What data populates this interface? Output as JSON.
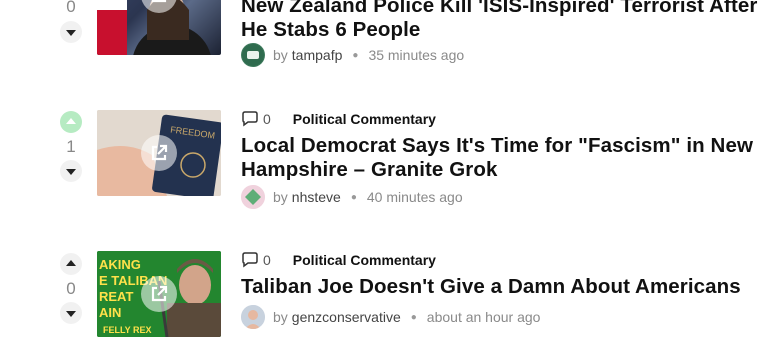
{
  "posts": [
    {
      "score": "0",
      "title": "New Zealand Police Kill 'ISIS-Inspired' Terrorist After He Stabs 6 People",
      "by_label": "by",
      "author": "tampafp",
      "time": "35 minutes ago",
      "avatar_icon": "tampafp-logo-icon",
      "thumb_icon": "news-photo"
    },
    {
      "score": "1",
      "comments": "0",
      "category": "Political Commentary",
      "title": "Local Democrat Says It's Time for \"Fascism\" in New Hampshire – Granite Grok",
      "by_label": "by",
      "author": "nhsteve",
      "time": "40 minutes ago",
      "upvoted": true,
      "passport_text": "FREEDOM"
    },
    {
      "score": "0",
      "comments": "0",
      "category": "Political Commentary",
      "title": "Taliban Joe Doesn't Give a Damn About Americans",
      "by_label": "by",
      "author": "genzconservative",
      "time": "about an hour ago",
      "thumb_text": [
        "AKING",
        "E TALIBAN",
        "REAT",
        "AIN",
        "FELLY REX"
      ]
    }
  ],
  "colors": {
    "upvote_active": "#b6ebc2",
    "vote_button": "#f1f1f1",
    "title": "#111111",
    "meta": "#8a8a8a"
  }
}
